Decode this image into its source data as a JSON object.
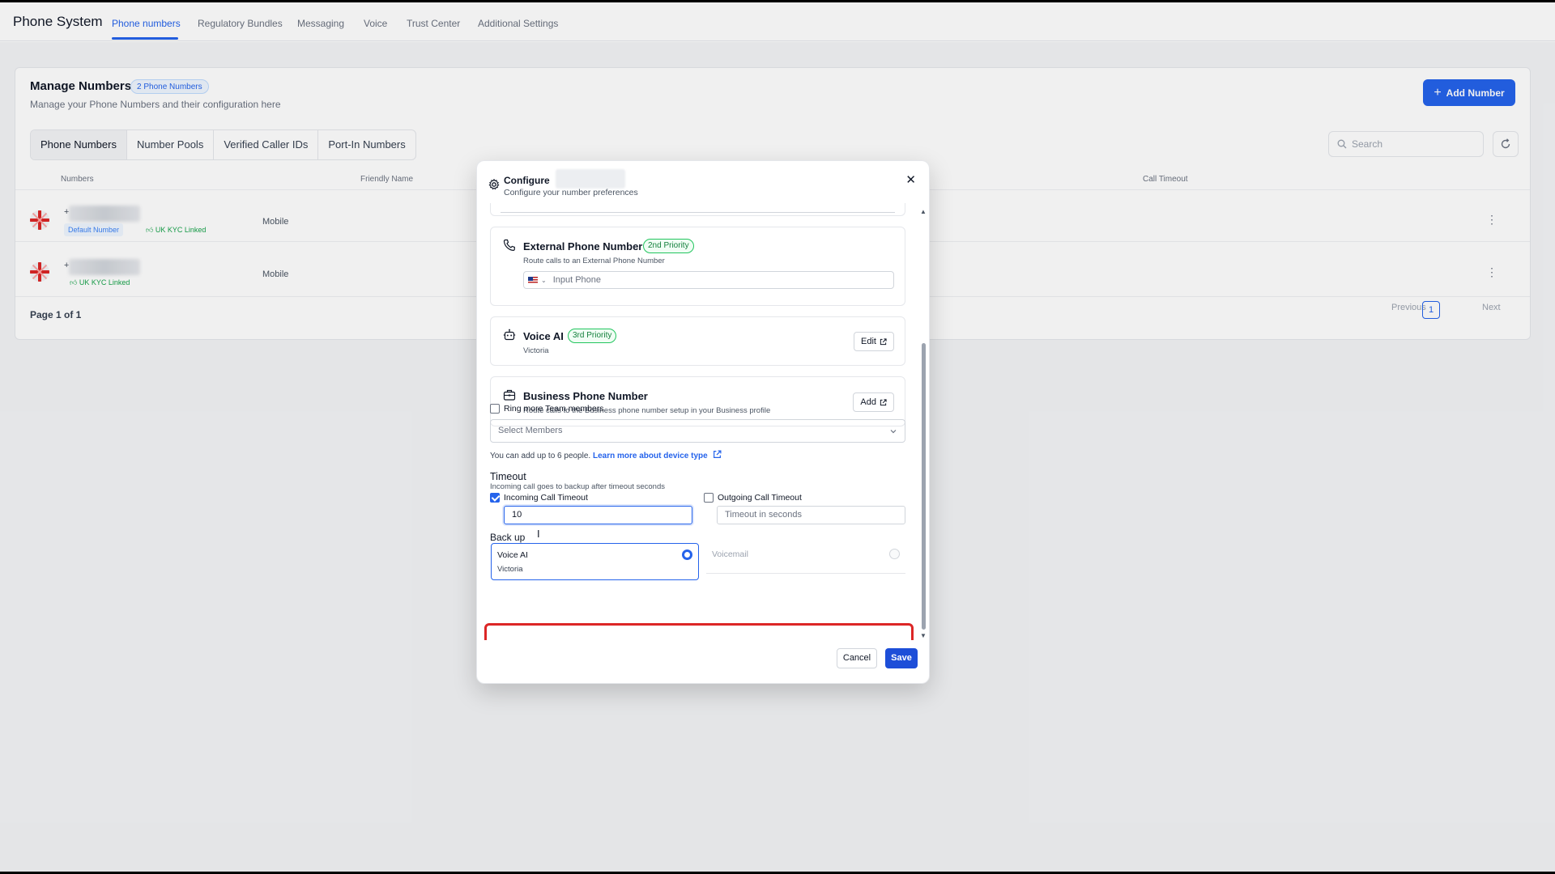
{
  "app": {
    "title": "Phone System",
    "tabs": [
      "Phone numbers",
      "Regulatory Bundles",
      "Messaging",
      "Voice",
      "Trust Center",
      "Additional Settings"
    ]
  },
  "manage": {
    "title": "Manage Numbers",
    "count_badge": "2 Phone Numbers",
    "subtitle": "Manage your Phone Numbers and their configuration here",
    "add_button": "Add Number",
    "subtabs": [
      "Phone Numbers",
      "Number Pools",
      "Verified Caller IDs",
      "Port-In Numbers"
    ],
    "search_placeholder": "Search",
    "columns": [
      "Numbers",
      "Friendly Name",
      "Call Timeout"
    ],
    "rows": [
      {
        "prefix": "+",
        "default_chip": "Default Number",
        "kyc_chip": "UK KYC Linked",
        "type": "Mobile"
      },
      {
        "prefix": "+",
        "default_chip": "",
        "kyc_chip": "UK KYC Linked",
        "type": "Mobile"
      }
    ],
    "page_text": "Page 1 of 1",
    "pager": {
      "previous": "Previous",
      "current": "1",
      "next": "Next"
    }
  },
  "modal": {
    "title": "Configure",
    "subtitle": "Configure your number preferences",
    "external": {
      "title": "External Phone Number",
      "priority": "2nd Priority",
      "subtitle": "Route calls to an External Phone Number",
      "input_placeholder": "Input Phone"
    },
    "voice_ai": {
      "title": "Voice AI",
      "priority": "3rd Priority",
      "subtitle": "Victoria",
      "button": "Edit"
    },
    "business": {
      "title": "Business Phone Number",
      "subtitle": "Route calls to the Business phone number setup in your Business profile",
      "button": "Add"
    },
    "ring_more": {
      "label": "Ring more Team members",
      "checked": false,
      "select_placeholder": "Select Members",
      "hint": "You can add up to 6 people.",
      "hint_link": "Learn more about device type"
    },
    "timeout": {
      "title": "Timeout",
      "subtitle": "Incoming call goes to backup after timeout seconds",
      "incoming_label": "Incoming Call Timeout",
      "incoming_checked": true,
      "incoming_value": "10",
      "outgoing_label": "Outgoing Call Timeout",
      "outgoing_checked": false,
      "outgoing_placeholder": "Timeout in seconds"
    },
    "backup": {
      "title": "Back up",
      "options": [
        {
          "title": "Voice AI",
          "subtitle": "Victoria",
          "selected": true
        },
        {
          "title": "Voicemail",
          "subtitle": "",
          "selected": false
        }
      ]
    },
    "cancel_label": "Cancel",
    "save_label": "Save"
  },
  "colors": {
    "accent": "#2563eb",
    "highlight": "#dc2626",
    "priority_green": "#22c55e"
  }
}
